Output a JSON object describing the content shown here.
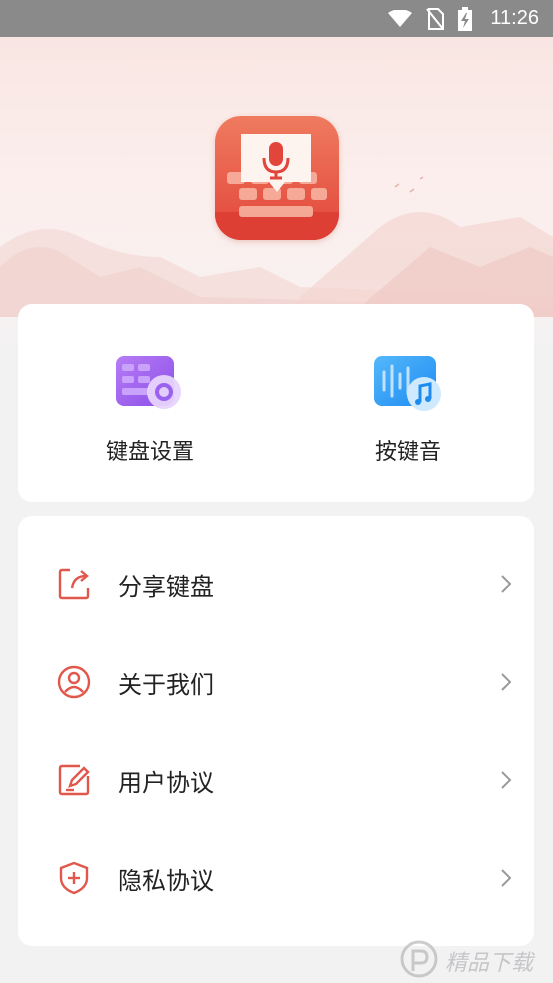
{
  "status_bar": {
    "time": "11:26"
  },
  "quick_actions": [
    {
      "label": "键盘设置",
      "icon": "keyboard-settings-icon"
    },
    {
      "label": "按键音",
      "icon": "key-sound-icon"
    }
  ],
  "menu": [
    {
      "label": "分享键盘",
      "icon": "share-icon"
    },
    {
      "label": "关于我们",
      "icon": "user-icon"
    },
    {
      "label": "用户协议",
      "icon": "edit-document-icon"
    },
    {
      "label": "隐私协议",
      "icon": "shield-plus-icon"
    }
  ],
  "watermark": {
    "text": "精品下载"
  },
  "colors": {
    "accent": "#e2574c",
    "status_bar": "#8a8a8a",
    "background": "#f2f2f3"
  }
}
